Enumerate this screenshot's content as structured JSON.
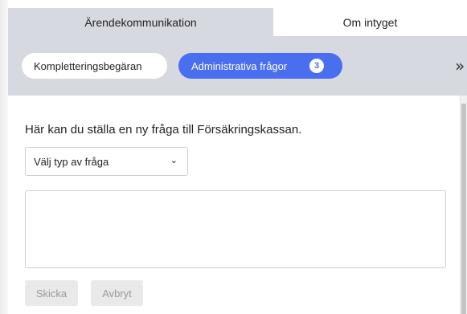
{
  "tabs": [
    {
      "label": "Ärendekommunikation",
      "active": true
    },
    {
      "label": "Om intyget",
      "active": false
    }
  ],
  "subtabs": {
    "kompletteringsbegaran_label": "Kompletteringsbegäran",
    "administrativa_label": "Administrativa frågor",
    "administrativa_count": "3",
    "expand_glyph": "»"
  },
  "form": {
    "intro_text": "Här kan du ställa en ny fråga till Försäkringskassan.",
    "select_value": "Välj typ av fråga",
    "message_value": "",
    "send_label": "Skicka",
    "cancel_label": "Avbryt"
  },
  "colors": {
    "accent": "#4a6ef0",
    "tab_background": "#d7d9e0",
    "disabled_button": "#e9e9e9"
  },
  "icons": {
    "expand": "double-chevron-right-icon",
    "select_caret": "chevron-down-icon"
  }
}
